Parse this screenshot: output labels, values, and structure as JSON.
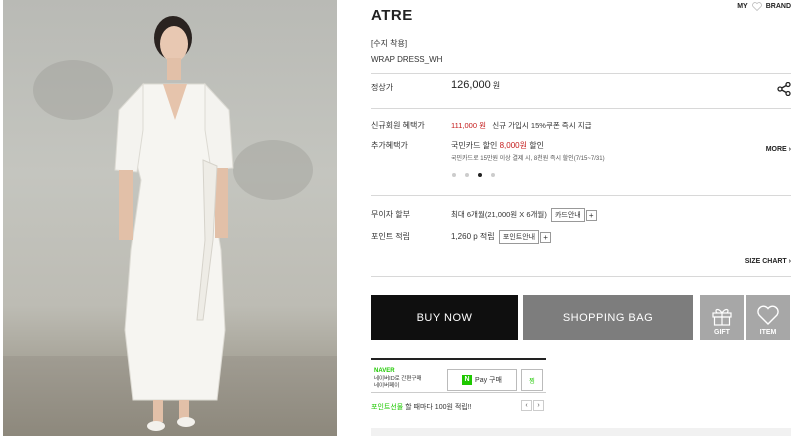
{
  "header": {
    "brand": "ATRE",
    "my_brand_left": "MY",
    "my_brand_right": "BRAND"
  },
  "product": {
    "sub_name": "[수지 착용]",
    "name": "WRAP DRESS_WH",
    "price_label": "정상가",
    "price": "126,000",
    "currency": "원"
  },
  "benefits": {
    "new_member_label": "신규회원 혜택가",
    "new_member_price": "111,000 원",
    "new_member_note": "신규 가입시 15%쿠폰 즉시 지급",
    "extra_label": "추가혜택가",
    "card_line_prefix": "국민카드 할인 ",
    "card_discount": "8,000원",
    "card_line_suffix": " 할인",
    "card_detail": "국민카드로 15만원 이상 결제 시, 8천원 즉시 할인(7/15~7/31)",
    "more": "MORE",
    "slides": 4,
    "active_slide": 3
  },
  "installment": {
    "label": "무이자 할부",
    "value": "최대 6개월(21,000원 X 6개월)",
    "button": "카드안내",
    "plus": "+"
  },
  "points": {
    "label": "포인트 적립",
    "value": "1,260 p 적립",
    "button": "포인트안내",
    "plus": "+"
  },
  "size_chart": "SIZE CHART",
  "actions": {
    "buy_now": "BUY NOW",
    "shopping_bag": "SHOPPING BAG",
    "gift": "GIFT",
    "item": "ITEM"
  },
  "npay": {
    "naver": "NAVER",
    "desc_line1": "네이버ID로 간편구매",
    "desc_line2": "네이버페이",
    "pay_logo": "N",
    "pay_label": "Pay 구매",
    "wish": "찜",
    "note_green": "포인트선물",
    "note_rest": " 할 때마다 100원 적립!!",
    "prev": "‹",
    "next": "›"
  },
  "colors": {
    "accent_red": "#c41b1b",
    "naver_green": "#1ec800",
    "buy_now_bg": "#0f0f0f",
    "bag_bg": "#7d7d7d",
    "square_btn_bg": "#a7a7a7"
  }
}
